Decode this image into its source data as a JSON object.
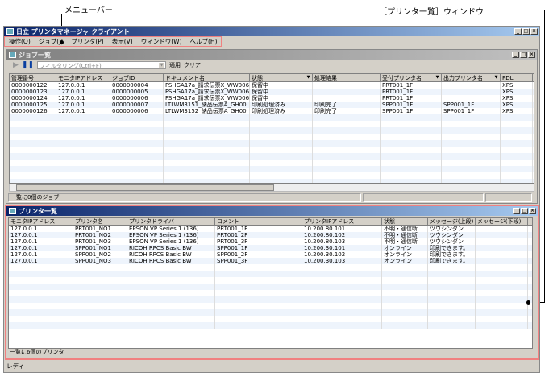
{
  "callouts": {
    "menubar": "メニューバー",
    "printer_window": "［プリンタ一覧］ウィンドウ"
  },
  "app": {
    "title": "日立 プリンタマネージャ クライアント",
    "status": "レディ",
    "menu": [
      "操作(O)",
      "ジョブ(J)",
      "プリンタ(P)",
      "表示(V)",
      "ウィンドウ(W)",
      "ヘルプ(H)"
    ]
  },
  "job_window": {
    "title": "ジョブ一覧",
    "filter_placeholder": "フィルタリング(Ctrl+F)",
    "apply": "適用",
    "clear": "クリア",
    "columns": [
      "管理番号",
      "モニタIPアドレス",
      "ジョブID",
      "ドキュメント名",
      "状態",
      "処理結果",
      "受付プリンタ名",
      "出力プリンタ名",
      "PDL"
    ],
    "rows": [
      [
        "0000000122",
        "127.0.0.1",
        "0000000004",
        "FSHGA17a_請求伝票X_WW006",
        "保留中",
        "",
        "PRT001_1F",
        "",
        "XPS"
      ],
      [
        "0000000123",
        "127.0.0.1",
        "0000000005",
        "FSHGA17a_請求伝票X_WW006",
        "保留中",
        "",
        "PRT001_1F",
        "",
        "XPS"
      ],
      [
        "0000000124",
        "127.0.0.1",
        "0000000006",
        "FSHGA17a_請求伝票X_WW006",
        "保留中",
        "",
        "PRT001_1F",
        "",
        "XPS"
      ],
      [
        "0000000125",
        "127.0.0.1",
        "0000000007",
        "LTLWM3151_納品伝票A_GH00",
        "印刷処理済み",
        "印刷完了",
        "SPP001_1F",
        "SPP001_1F",
        "XPS"
      ],
      [
        "0000000126",
        "127.0.0.1",
        "0000000006",
        "LTLWM3152_納品伝票A_GH00",
        "印刷処理済み",
        "印刷完了",
        "SPP001_1F",
        "SPP001_1F",
        "XPS"
      ]
    ],
    "status": "一覧に0個のジョブ"
  },
  "printer_window": {
    "title": "プリンタ一覧",
    "columns": [
      "モニタIPアドレス",
      "プリンタ名",
      "プリンタドライバ",
      "コメント",
      "プリンタIPアドレス",
      "状態",
      "メッセージ(上段)",
      "メッセージ(下段)"
    ],
    "rows": [
      [
        "127.0.0.1",
        "PRT001_NO1",
        "EPSON VP Series 1 (136)",
        "PRT001_1F",
        "10.200.80.101",
        "不明・通信断",
        "ツウシンダン",
        ""
      ],
      [
        "127.0.0.1",
        "PRT001_NO2",
        "EPSON VP Series 1 (136)",
        "PRT001_2F",
        "10.200.80.102",
        "不明・通信断",
        "ツウシンダン",
        ""
      ],
      [
        "127.0.0.1",
        "PRT001_NO3",
        "EPSON VP Series 1 (136)",
        "PRT001_3F",
        "10.200.80.103",
        "不明・通信断",
        "ツウシンダン",
        ""
      ],
      [
        "127.0.0.1",
        "SPP001_NO1",
        "RICOH RPCS Basic BW",
        "SPP001_1F",
        "10.200.30.101",
        "オンライン",
        "印刷できます。",
        ""
      ],
      [
        "127.0.0.1",
        "SPP001_NO2",
        "RICOH RPCS Basic BW",
        "SPP001_2F",
        "10.200.30.102",
        "オンライン",
        "印刷できます。",
        ""
      ],
      [
        "127.0.0.1",
        "SPP001_NO3",
        "RICOH RPCS Basic BW",
        "SPP001_3F",
        "10.200.30.103",
        "オンライン",
        "印刷できます。",
        ""
      ]
    ],
    "status": "一覧に6個のプリンタ"
  },
  "colors": {
    "highlight": "#f08080",
    "active_title": "#0a246a"
  }
}
